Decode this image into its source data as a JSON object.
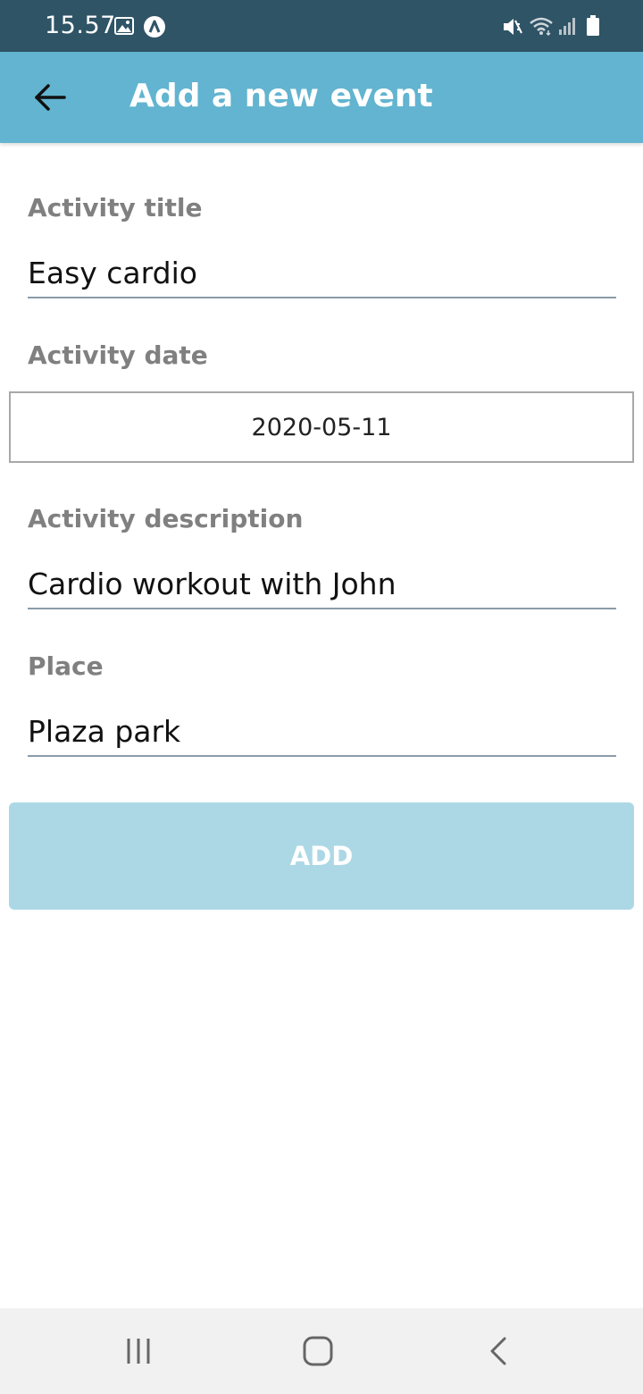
{
  "status_bar": {
    "time": "15.57",
    "icons": [
      "image-icon",
      "app-notification-icon",
      "mute-icon",
      "wifi-icon",
      "signal-icon",
      "battery-icon"
    ]
  },
  "app_bar": {
    "title": "Add a new event",
    "back_icon": "arrow-left-icon",
    "background_color": "#62b4d0"
  },
  "form": {
    "title": {
      "label": "Activity title",
      "value": "Easy cardio"
    },
    "date": {
      "label": "Activity date",
      "value": "2020-05-11"
    },
    "description": {
      "label": "Activity description",
      "value": "Cardio workout with John"
    },
    "place": {
      "label": "Place",
      "value": "Plaza park"
    }
  },
  "add_button": {
    "label": "ADD",
    "color": "#acd8e6"
  },
  "nav_bar": {
    "icons": [
      "recent-apps-icon",
      "home-icon",
      "back-nav-icon"
    ]
  }
}
